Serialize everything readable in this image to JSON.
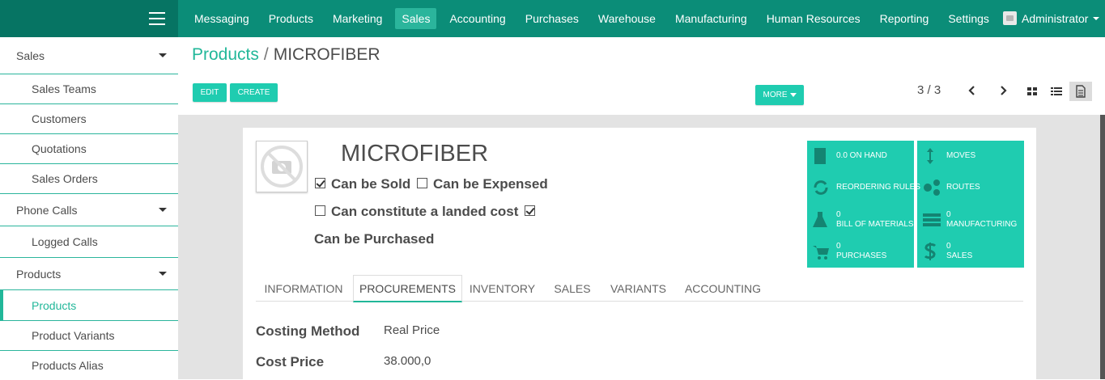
{
  "topnav": {
    "items": [
      {
        "label": "Messaging",
        "active": false
      },
      {
        "label": "Products",
        "active": false
      },
      {
        "label": "Marketing",
        "active": false
      },
      {
        "label": "Sales",
        "active": true
      },
      {
        "label": "Accounting",
        "active": false
      },
      {
        "label": "Purchases",
        "active": false
      },
      {
        "label": "Warehouse",
        "active": false
      },
      {
        "label": "Manufacturing",
        "active": false
      },
      {
        "label": "Human Resources",
        "active": false
      },
      {
        "label": "Reporting",
        "active": false
      },
      {
        "label": "Settings",
        "active": false
      }
    ],
    "user": "Administrator"
  },
  "sidebar": {
    "sales_section": "Sales",
    "sales_teams": "Sales Teams",
    "customers": "Customers",
    "quotations": "Quotations",
    "sales_orders": "Sales Orders",
    "phone_calls_section": "Phone Calls",
    "logged_calls": "Logged Calls",
    "products_section": "Products",
    "products": "Products",
    "product_variants": "Product Variants",
    "products_alias": "Products Alias"
  },
  "breadcrumb": {
    "parent": "Products",
    "separator": "/",
    "current": "MICROFIBER"
  },
  "toolbar": {
    "edit_label": "EDIT",
    "create_label": "CREATE",
    "more_label": "MORE"
  },
  "pager": {
    "text": "3 / 3"
  },
  "form": {
    "name": "MICROFIBER",
    "can_be_sold": {
      "label": "Can be Sold",
      "checked": true
    },
    "can_be_expensed": {
      "label": "Can be Expensed",
      "checked": false
    },
    "landed_cost": {
      "label": "Can constitute a landed cost",
      "checked": false
    },
    "can_be_purchased": {
      "label": "Can be Purchased",
      "checked": true
    }
  },
  "stats": {
    "on_hand": "0.0 ON HAND",
    "moves": "MOVES",
    "reordering_rules": "REORDERING RULES",
    "routes": "ROUTES",
    "bom_count": "0",
    "bom_label": "BILL OF MATERIALS",
    "manufacturing_count": "0",
    "manufacturing_label": "MANUFACTURING",
    "purchases_count": "0",
    "purchases_label": "PURCHASES",
    "sales_count": "0",
    "sales_label": "SALES"
  },
  "tabs": [
    "INFORMATION",
    "PROCUREMENTS",
    "INVENTORY",
    "SALES",
    "VARIANTS",
    "ACCOUNTING"
  ],
  "procurements": {
    "costing_method_label": "Costing Method",
    "costing_method_value": "Real Price",
    "cost_price_label": "Cost Price",
    "cost_price_value": "38.000,0"
  },
  "colors": {
    "topbar": "#0b8d78",
    "brand_area": "#067463",
    "accent": "#21b799",
    "button": "#1fccb0"
  },
  "icons": [
    "hamburger-icon",
    "chevron-left-icon",
    "chevron-right-icon",
    "kanban-view-icon",
    "list-view-icon",
    "form-view-icon",
    "no-image-icon",
    "building-icon",
    "moves-icon",
    "refresh-icon",
    "routes-icon",
    "flask-icon",
    "list-icon",
    "cart-icon",
    "dollar-icon"
  ]
}
